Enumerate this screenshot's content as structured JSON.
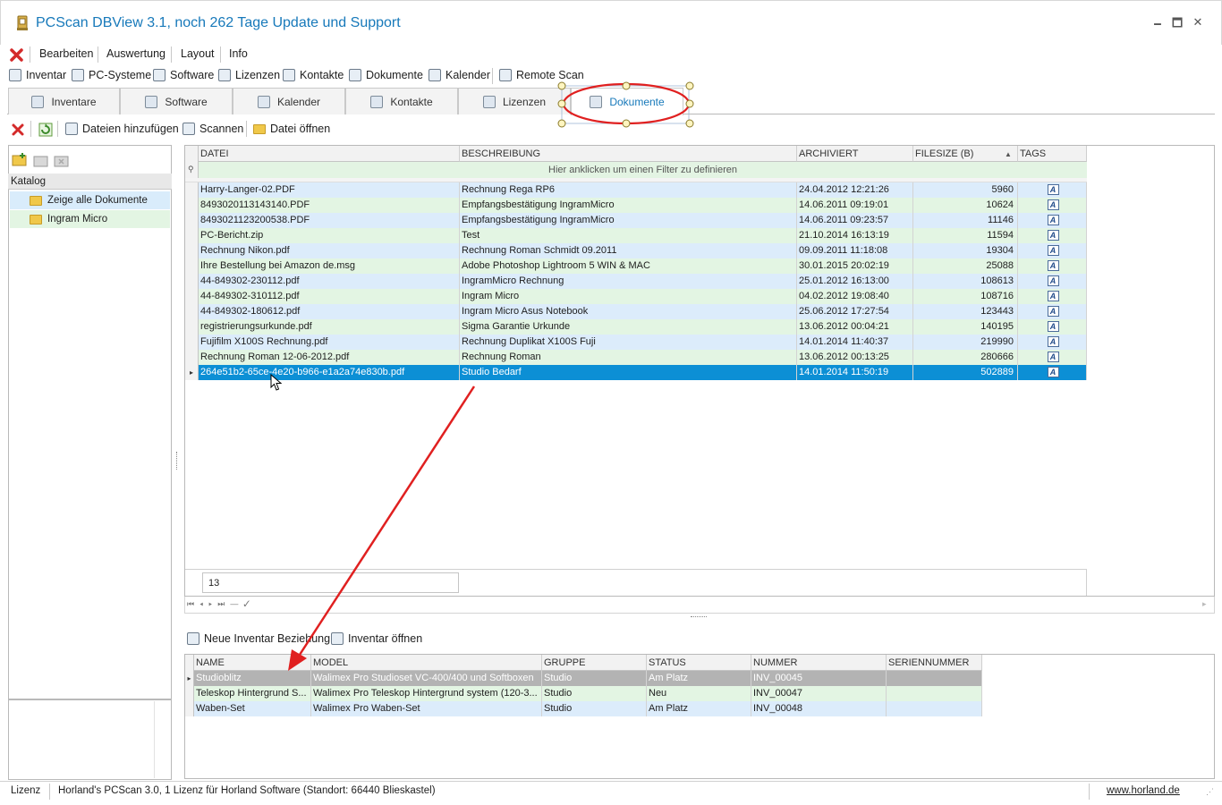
{
  "window": {
    "title": "PCScan DBView 3.1, noch 262 Tage Update und Support",
    "minimize": "🗕",
    "maximize": "🗖",
    "close": "✕"
  },
  "menu": [
    "Bearbeiten",
    "Auswertung",
    "Layout",
    "Info"
  ],
  "quick": [
    "Inventar",
    "PC-Systeme",
    "Software",
    "Lizenzen",
    "Kontakte",
    "Dokumente",
    "Kalender",
    "Remote Scan"
  ],
  "tabs": [
    "Inventare",
    "Software",
    "Kalender",
    "Kontakte",
    "Lizenzen",
    "Dokumente"
  ],
  "docbar": {
    "add": "Dateien hinzufügen",
    "scan": "Scannen",
    "open": "Datei öffnen"
  },
  "catalog": {
    "title": "Katalog",
    "items": [
      "Zeige alle Dokumente",
      "Ingram Micro"
    ]
  },
  "grid": {
    "headers": [
      "DATEI",
      "BESCHREIBUNG",
      "ARCHIVIERT",
      "FILESIZE (B)",
      "TAGS"
    ],
    "filter": "Hier anklicken um einen Filter zu definieren",
    "rows": [
      [
        "Harry-Langer-02.PDF",
        "Rechnung Rega RP6",
        "24.04.2012 12:21:26",
        "5960"
      ],
      [
        "8493020113143140.PDF",
        "Empfangsbestätigung IngramMicro",
        "14.06.2011 09:19:01",
        "10624"
      ],
      [
        "8493021123200538.PDF",
        "Empfangsbestätigung IngramMicro",
        "14.06.2011 09:23:57",
        "11146"
      ],
      [
        "PC-Bericht.zip",
        "Test",
        "21.10.2014 16:13:19",
        "11594"
      ],
      [
        "Rechnung Nikon.pdf",
        "Rechnung Roman Schmidt 09.2011",
        "09.09.2011 11:18:08",
        "19304"
      ],
      [
        "Ihre Bestellung bei Amazon de.msg",
        "Adobe Photoshop Lightroom 5 WIN & MAC",
        "30.01.2015 20:02:19",
        "25088"
      ],
      [
        "44-849302-230112.pdf",
        "IngramMicro Rechnung",
        "25.01.2012 16:13:00",
        "108613"
      ],
      [
        "44-849302-310112.pdf",
        "Ingram Micro",
        "04.02.2012 19:08:40",
        "108716"
      ],
      [
        "44-849302-180612.pdf",
        "Ingram Micro Asus Notebook",
        "25.06.2012 17:27:54",
        "123443"
      ],
      [
        "registrierungsurkunde.pdf",
        "Sigma Garantie Urkunde",
        "13.06.2012 00:04:21",
        "140195"
      ],
      [
        "Fujifilm X100S Rechnung.pdf",
        "Rechnung Duplikat X100S Fuji",
        "14.01.2014 11:40:37",
        "219990"
      ],
      [
        "Rechnung Roman 12-06-2012.pdf",
        "Rechnung Roman",
        "13.06.2012 00:13:25",
        "280666"
      ],
      [
        "264e51b2-65ce-4e20-b966-e1a2a74e830b.pdf",
        "Studio Bedarf",
        "14.01.2014 11:50:19",
        "502889"
      ]
    ],
    "tag_glyph": "A",
    "count": "13"
  },
  "inventory": {
    "new": "Neue Inventar Beziehung",
    "open": "Inventar öffnen",
    "headers": [
      "NAME",
      "MODEL",
      "GRUPPE",
      "STATUS",
      "NUMMER",
      "SERIENNUMMER"
    ],
    "rows": [
      [
        "Studioblitz",
        "Walimex Pro Studioset VC-400/400 und Softboxen",
        "Studio",
        "Am Platz",
        "INV_00045",
        ""
      ],
      [
        "Teleskop Hintergrund S...",
        "Walimex Pro Teleskop Hintergrund system (120-3...",
        "Studio",
        "Neu",
        "INV_00047",
        ""
      ],
      [
        "Waben-Set",
        "Walimex Pro Waben-Set",
        "Studio",
        "Am Platz",
        "INV_00048",
        ""
      ]
    ]
  },
  "status": {
    "license": "Lizenz",
    "text": "Horland's PCScan 3.0, 1 Lizenz für Horland Software (Standort: 66440 Blieskastel)",
    "link": "www.horland.de"
  },
  "colors": {
    "accent": "#1779ba",
    "annotation": "#e02020",
    "selected": "#0c8fd5"
  }
}
